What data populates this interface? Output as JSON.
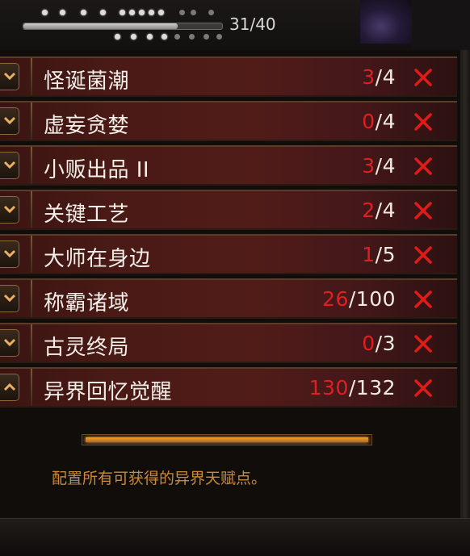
{
  "header": {
    "progress_text": "31/40",
    "progress_fraction": 0.775
  },
  "tasks": [
    {
      "name": "怪诞菌潮",
      "current": "3",
      "total": "/4",
      "status_icon": "red-x-icon",
      "expand_icon": "chevron-down-icon"
    },
    {
      "name": "虚妄贪婪",
      "current": "0",
      "total": "/4",
      "status_icon": "red-x-icon",
      "expand_icon": "chevron-down-icon"
    },
    {
      "name": "小贩出品 II",
      "current": "3",
      "total": "/4",
      "status_icon": "red-x-icon",
      "expand_icon": "chevron-down-icon"
    },
    {
      "name": "关键工艺",
      "current": "2",
      "total": "/4",
      "status_icon": "red-x-icon",
      "expand_icon": "chevron-down-icon"
    },
    {
      "name": "大师在身边",
      "current": "1",
      "total": "/5",
      "status_icon": "red-x-icon",
      "expand_icon": "chevron-down-icon"
    },
    {
      "name": "称霸诸域",
      "current": "26",
      "total": "/100",
      "status_icon": "red-x-icon",
      "expand_icon": "chevron-down-icon"
    },
    {
      "name": "古灵终局",
      "current": "0",
      "total": "/3",
      "status_icon": "red-x-icon",
      "expand_icon": "chevron-down-icon"
    },
    {
      "name": "异界回忆觉醒",
      "current": "130",
      "total": "/132",
      "status_icon": "red-x-icon",
      "expand_icon": "chevron-up-icon"
    }
  ],
  "footer": {
    "description": "配置所有可获得的异界天赋点。"
  },
  "colors": {
    "count_current": "#e02020",
    "count_total": "#f0ebe0",
    "description": "#c98a3a",
    "bar_fill": "#f2a030"
  }
}
